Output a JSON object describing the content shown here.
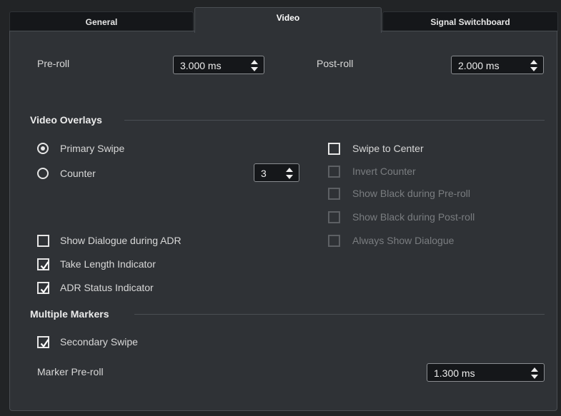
{
  "tabs": {
    "general": "General",
    "video": "Video",
    "signal_switchboard": "Signal Switchboard",
    "active": "Video"
  },
  "preroll": {
    "label": "Pre-roll",
    "value": "3.000 ms"
  },
  "postroll": {
    "label": "Post-roll",
    "value": "2.000 ms"
  },
  "video_overlays": {
    "title": "Video Overlays",
    "primary_swipe": {
      "label": "Primary Swipe",
      "selected": true
    },
    "counter": {
      "label": "Counter",
      "selected": false,
      "value": "3"
    },
    "swipe_to_center": {
      "label": "Swipe to Center",
      "checked": false,
      "enabled": true
    },
    "invert_counter": {
      "label": "Invert Counter",
      "checked": false,
      "enabled": false
    },
    "show_black_preroll": {
      "label": "Show Black during Pre-roll",
      "checked": false,
      "enabled": false
    },
    "show_black_postroll": {
      "label": "Show Black during Post-roll",
      "checked": false,
      "enabled": false
    },
    "always_show_dialogue": {
      "label": "Always Show Dialogue",
      "checked": false,
      "enabled": false
    },
    "show_dialogue_adr": {
      "label": "Show Dialogue during ADR",
      "checked": false
    },
    "take_length_indicator": {
      "label": "Take Length Indicator",
      "checked": true
    },
    "adr_status_indicator": {
      "label": "ADR Status Indicator",
      "checked": true
    }
  },
  "multiple_markers": {
    "title": "Multiple Markers",
    "secondary_swipe": {
      "label": "Secondary Swipe",
      "checked": true
    },
    "marker_preroll": {
      "label": "Marker Pre-roll",
      "value": "1.300 ms"
    }
  },
  "colors": {
    "background": "#222426",
    "panel": "#2f3236",
    "field": "#15171a",
    "text": "#d8d8d8",
    "disabled_text": "#7a7d80"
  }
}
